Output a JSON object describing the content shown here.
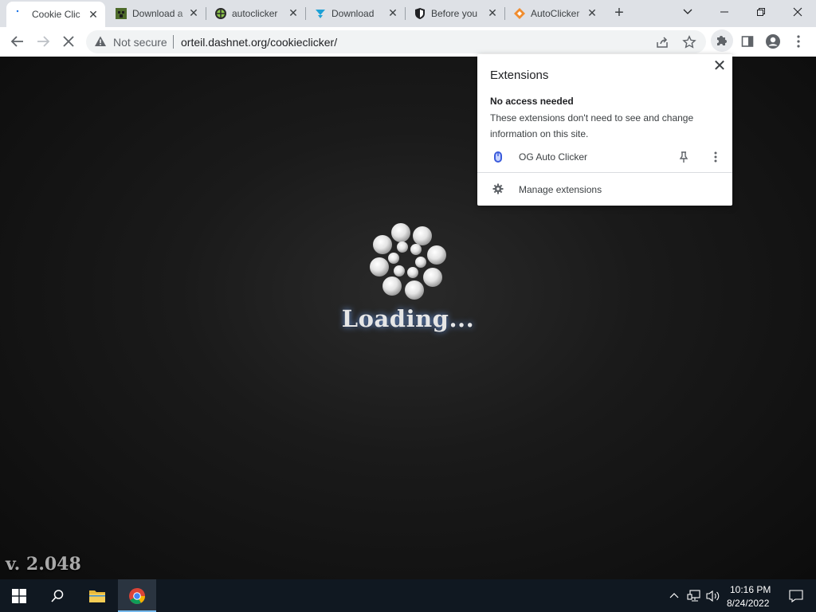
{
  "browser": {
    "tabs": [
      {
        "title": "Cookie Clic",
        "active": true
      },
      {
        "title": "Download a"
      },
      {
        "title": "autoclicker"
      },
      {
        "title": "Download"
      },
      {
        "title": "Before you"
      },
      {
        "title": "AutoClicker"
      }
    ],
    "new_tab_glyph": "+",
    "close_glyph": "✕"
  },
  "toolbar": {
    "security_label": "Not secure",
    "url": "orteil.dashnet.org/cookieclicker/"
  },
  "page": {
    "loading_text": "Loading...",
    "version": "v. 2.048"
  },
  "extensions_popup": {
    "title": "Extensions",
    "close_glyph": "✕",
    "section_heading": "No access needed",
    "section_description": "These extensions don't need to see and change information on this site.",
    "extensions": [
      {
        "name": "OG Auto Clicker",
        "icon": "og-auto-clicker-icon"
      }
    ],
    "manage_label": "Manage extensions"
  },
  "taskbar": {
    "time": "10:16 PM",
    "date": "8/24/2022"
  },
  "colors": {
    "tabstrip": "#dee1e6",
    "taskbar": "#101821",
    "loading_glow": "#78aaff"
  }
}
